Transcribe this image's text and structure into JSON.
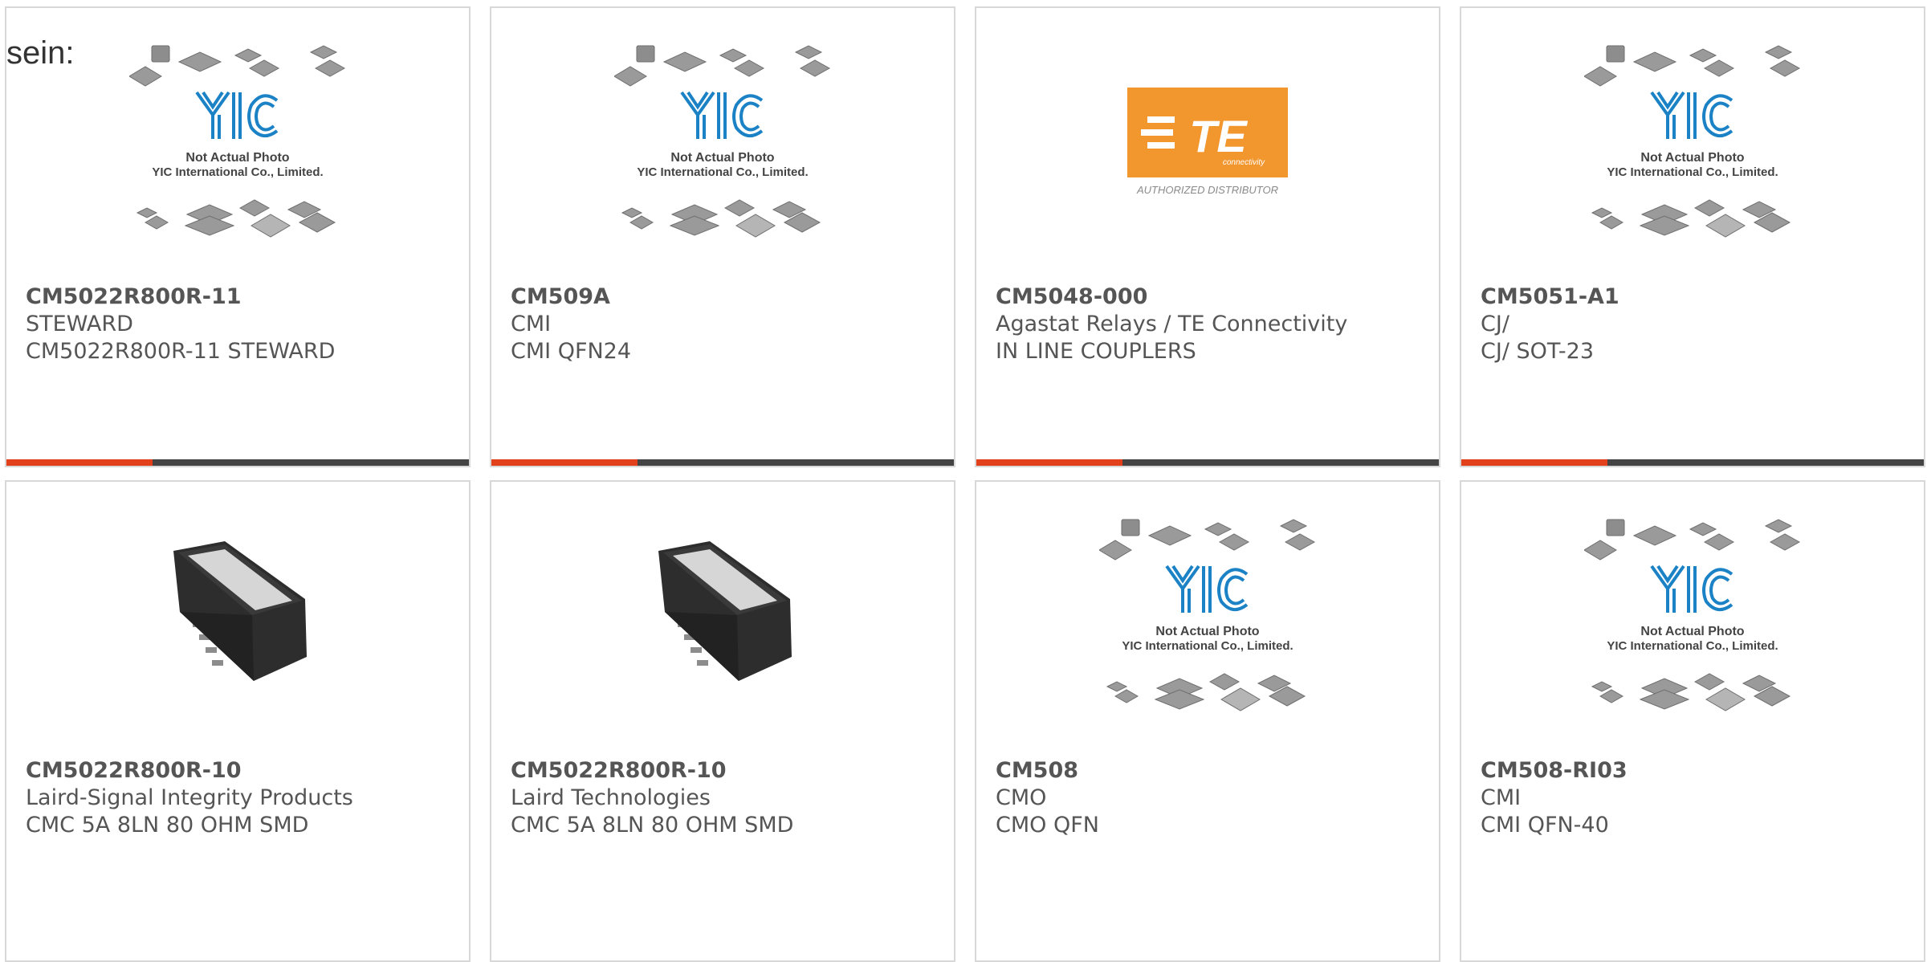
{
  "intro_text": "sein:",
  "colors": {
    "accent": "#e2401b",
    "bar": "#444444",
    "te_orange": "#f2962e",
    "yic_blue": "#1b82c5"
  },
  "placeholder": {
    "line1": "Not Actual Photo",
    "line2": "YIC International Co., Limited.",
    "logo": "YIC"
  },
  "te_logo": {
    "brand": "TE",
    "sub": "connectivity",
    "tagline": "AUTHORIZED DISTRIBUTOR"
  },
  "products": [
    {
      "part": "CM5022R800R-11",
      "manufacturer": "STEWARD",
      "description": "CM5022R800R-11 STEWARD",
      "image": "yic-placeholder"
    },
    {
      "part": "CM509A",
      "manufacturer": "CMI",
      "description": "CMI QFN24",
      "image": "yic-placeholder"
    },
    {
      "part": "CM5048-000",
      "manufacturer": "Agastat Relays / TE Connectivity",
      "description": "IN LINE COUPLERS",
      "image": "te-logo"
    },
    {
      "part": "CM5051-A1",
      "manufacturer": "CJ/",
      "description": "CJ/ SOT-23",
      "image": "yic-placeholder"
    },
    {
      "part": "CM5022R800R-10",
      "manufacturer": "Laird-Signal Integrity Products",
      "description": "CMC 5A 8LN 80 OHM SMD",
      "image": "smd-choke"
    },
    {
      "part": "CM5022R800R-10",
      "manufacturer": "Laird Technologies",
      "description": "CMC 5A 8LN 80 OHM SMD",
      "image": "smd-choke"
    },
    {
      "part": "CM508",
      "manufacturer": "CMO",
      "description": "CMO QFN",
      "image": "yic-placeholder"
    },
    {
      "part": "CM508-RI03",
      "manufacturer": "CMI",
      "description": "CMI QFN-40",
      "image": "yic-placeholder"
    }
  ]
}
